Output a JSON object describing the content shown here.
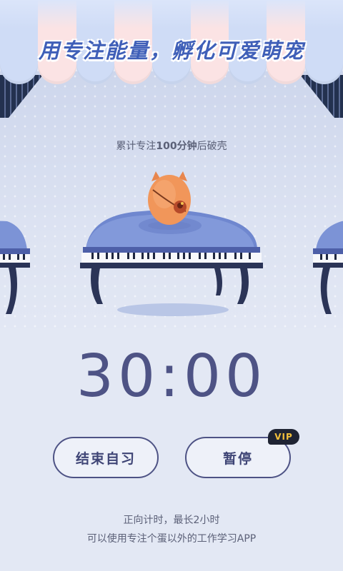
{
  "banner": {
    "headline": "用专注能量，孵化可爱萌宠"
  },
  "progress": {
    "prefix": "累计专注",
    "amount": "100分钟",
    "suffix": "后破壳"
  },
  "timer": {
    "value": "30:00"
  },
  "buttons": {
    "end_label": "结束自习",
    "pause_label": "暂停",
    "vip_badge": "VIP"
  },
  "notes": {
    "line1": "正向计时，最长2小时",
    "line2": "可以使用专注个蛋以外的工作学习APP"
  },
  "colors": {
    "accent": "#4e5385",
    "headline": "#3f5fb8",
    "awning_blue": "#cfdcf6",
    "awning_pink": "#fbe3e4",
    "vip_bg": "#1f2433",
    "vip_text": "#f4c13b"
  }
}
